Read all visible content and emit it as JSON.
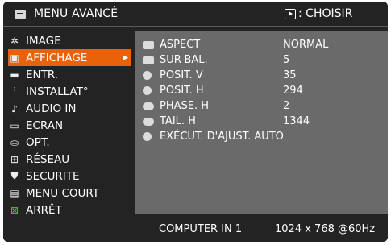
{
  "header": {
    "title": "MENU AVANCÉ",
    "choose_label": ": CHOISIR"
  },
  "sidebar": {
    "items": [
      {
        "label": "IMAGE",
        "icon": "✲"
      },
      {
        "label": "AFFICHAGE",
        "icon": "▣",
        "active": true
      },
      {
        "label": "ENTR.",
        "icon": "▬"
      },
      {
        "label": "INSTALLAT°",
        "icon": "⫶"
      },
      {
        "label": "AUDIO IN",
        "icon": "♪"
      },
      {
        "label": "ECRAN",
        "icon": "▭"
      },
      {
        "label": "OPT.",
        "icon": "⛀"
      },
      {
        "label": "RÉSEAU",
        "icon": "⊞"
      },
      {
        "label": "SECURITE",
        "icon": "⛊"
      },
      {
        "label": "MENU COURT",
        "icon": "▤"
      },
      {
        "label": "ARRÊT",
        "icon": "⊠"
      }
    ]
  },
  "panel": {
    "rows": [
      {
        "label": "ASPECT",
        "value": "NORMAL"
      },
      {
        "label": "SUR-BAL.",
        "value": "5"
      },
      {
        "label": "POSIT. V",
        "value": "35"
      },
      {
        "label": "POSIT. H",
        "value": "294"
      },
      {
        "label": "PHASE. H",
        "value": "2"
      },
      {
        "label": "TAIL. H",
        "value": "1344"
      },
      {
        "label": "EXÉCUT. D'AJUST. AUTO",
        "value": ""
      }
    ]
  },
  "footer": {
    "source": "COMPUTER IN 1",
    "resolution": "1024 x 768 @60Hz"
  },
  "colors": {
    "accent": "#e8620c",
    "background": "#232323",
    "panel": "#6a6a6a"
  }
}
